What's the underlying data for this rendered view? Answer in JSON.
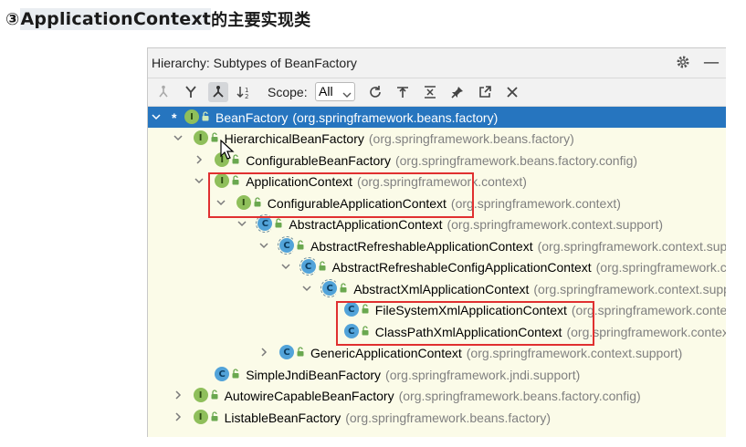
{
  "heading": {
    "number": "③",
    "highlight": "ApplicationContext",
    "rest": "的主要实现类"
  },
  "panel": {
    "title": "Hierarchy:  Subtypes of BeanFactory",
    "toolbar": {
      "scope_label": "Scope:",
      "scope_value": "All"
    }
  },
  "tree": [
    {
      "name": "BeanFactory",
      "pkg": "(org.springframework.beans.factory)",
      "kind": "interface",
      "expand": "down",
      "star": true,
      "selected": true
    },
    {
      "name": "HierarchicalBeanFactory",
      "pkg": "(org.springframework.beans.factory)",
      "kind": "interface",
      "expand": "down"
    },
    {
      "name": "ConfigurableBeanFactory",
      "pkg": "(org.springframework.beans.factory.config)",
      "kind": "interface",
      "expand": "right"
    },
    {
      "name": "ApplicationContext",
      "pkg": "(org.springframework.context)",
      "kind": "interface",
      "expand": "down"
    },
    {
      "name": "ConfigurableApplicationContext",
      "pkg": "(org.springframework.context)",
      "kind": "interface",
      "expand": "down"
    },
    {
      "name": "AbstractApplicationContext",
      "pkg": "(org.springframework.context.support)",
      "kind": "abstract",
      "expand": "down"
    },
    {
      "name": "AbstractRefreshableApplicationContext",
      "pkg": "(org.springframework.context.support)",
      "kind": "abstract",
      "expand": "down"
    },
    {
      "name": "AbstractRefreshableConfigApplicationContext",
      "pkg": "(org.springframework.context.support)",
      "kind": "abstract",
      "expand": "down"
    },
    {
      "name": "AbstractXmlApplicationContext",
      "pkg": "(org.springframework.context.support)",
      "kind": "abstract",
      "expand": "down"
    },
    {
      "name": "FileSystemXmlApplicationContext",
      "pkg": "(org.springframework.context.support)",
      "kind": "class",
      "expand": "none"
    },
    {
      "name": "ClassPathXmlApplicationContext",
      "pkg": "(org.springframework.context.support)",
      "kind": "class",
      "expand": "none"
    },
    {
      "name": "GenericApplicationContext",
      "pkg": "(org.springframework.context.support)",
      "kind": "class",
      "expand": "right"
    },
    {
      "name": "SimpleJndiBeanFactory",
      "pkg": "(org.springframework.jndi.support)",
      "kind": "class",
      "expand": "none"
    },
    {
      "name": "AutowireCapableBeanFactory",
      "pkg": "(org.springframework.beans.factory.config)",
      "kind": "interface",
      "expand": "right"
    },
    {
      "name": "ListableBeanFactory",
      "pkg": "(org.springframework.beans.factory)",
      "kind": "interface",
      "expand": "right"
    }
  ],
  "icons": {
    "toolbar": [
      "supertypes-icon",
      "subtypes-icon",
      "class-hierarchy-icon",
      "sort-alpha-icon",
      "refresh-icon",
      "pin-scope-icon",
      "expand-all-icon",
      "pin-icon",
      "export-icon",
      "close-icon"
    ],
    "titlebar": [
      "gear-icon",
      "minimize-icon"
    ]
  },
  "colors": {
    "selection": "#2675bf",
    "tree_background": "#fbfbe8",
    "interface_icon": "#8fbf5b",
    "class_icon": "#52a3d9",
    "annotation_box": "#e03030"
  }
}
